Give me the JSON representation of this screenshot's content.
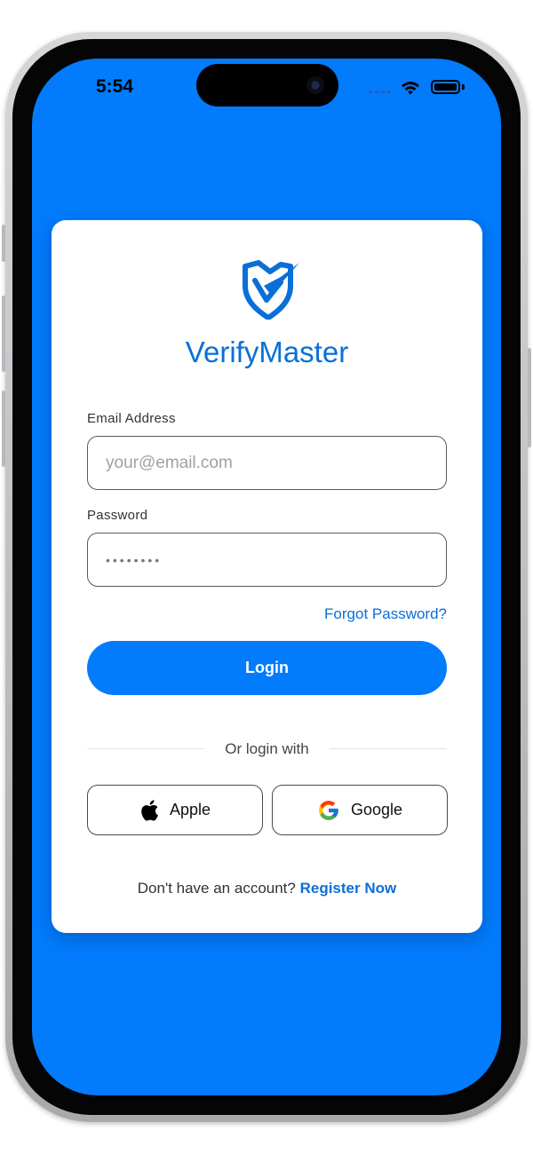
{
  "status_bar": {
    "time": "5:54"
  },
  "app": {
    "name": "VerifyMaster"
  },
  "form": {
    "email_label": "Email Address",
    "email_placeholder": "your@email.com",
    "password_label": "Password",
    "password_value": "••••••••",
    "forgot_password": "Forgot Password?",
    "login_label": "Login"
  },
  "social": {
    "divider_text": "Or login with",
    "apple_label": "Apple",
    "google_label": "Google"
  },
  "footer": {
    "prompt": "Don't have an account?",
    "register_label": "Register Now"
  },
  "colors": {
    "background": "#027BFD",
    "accent": "#0A6FD8",
    "card": "#FFFFFF"
  },
  "icons": [
    "shield-check-logo-icon",
    "apple-icon",
    "google-icon",
    "wifi-icon",
    "battery-icon",
    "cellular-signal-icon"
  ]
}
